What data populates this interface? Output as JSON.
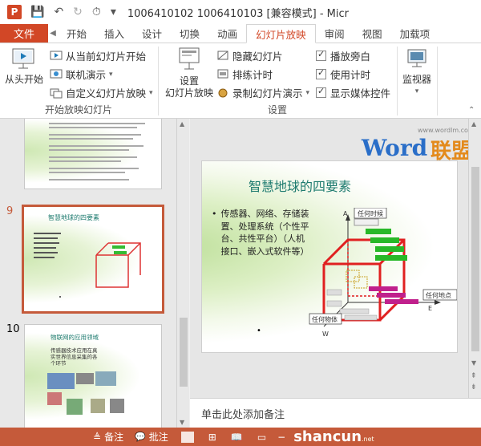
{
  "titlebar": {
    "app_icon": "P",
    "title": "1006410102 1006410103 [兼容模式] - Micr"
  },
  "tabs": {
    "file": "文件",
    "items": [
      "开始",
      "插入",
      "设计",
      "切换",
      "动画",
      "幻灯片放映",
      "审阅",
      "视图",
      "加载项"
    ],
    "active": "幻灯片放映"
  },
  "ribbon": {
    "group1": {
      "label": "开始放映幻灯片",
      "from_beginning": "从头开始",
      "from_current": "从当前幻灯片开始",
      "online": "联机演示",
      "custom": "自定义幻灯片放映"
    },
    "group2": {
      "label": "设置",
      "setup_line1": "设置",
      "setup_line2": "幻灯片放映",
      "hide": "隐藏幻灯片",
      "rehearse": "排练计时",
      "record": "录制幻灯片演示",
      "play_narrations": "播放旁白",
      "use_timings": "使用计时",
      "show_media": "显示媒体控件"
    },
    "group3": {
      "monitor": "监视器"
    }
  },
  "watermark": {
    "word": "Word",
    "lianmeng": "联盟",
    "url": "www.wordlm.com"
  },
  "slides": {
    "slide9_num": "9",
    "slide10_num": "10",
    "slide9_title": "智慧地球的四要素",
    "slide10_title": "物联网的应用领域",
    "slide10_bullet": "传感器技术应用在真实世界信息采集的各个环节"
  },
  "main_slide": {
    "title": "智慧地球的四要素",
    "bullet": "传感器、网络、存储装置、处理系统（个性平台、共性平台）（人机接口、嵌入式软件等）",
    "diagram": {
      "axis_a": "A",
      "axis_e": "E",
      "axis_w": "W",
      "any_time": "任何时候",
      "any_place": "任何地点",
      "any_object": "任何物体"
    }
  },
  "notes_placeholder": "单击此处添加备注",
  "statusbar": {
    "notes": "备注",
    "comments": "批注",
    "shancun": "shancun",
    "shancun_net": ".net"
  },
  "colors": {
    "accent": "#d24726",
    "statusbar": "#c55a3a",
    "slide_title": "#1e7b6f"
  }
}
